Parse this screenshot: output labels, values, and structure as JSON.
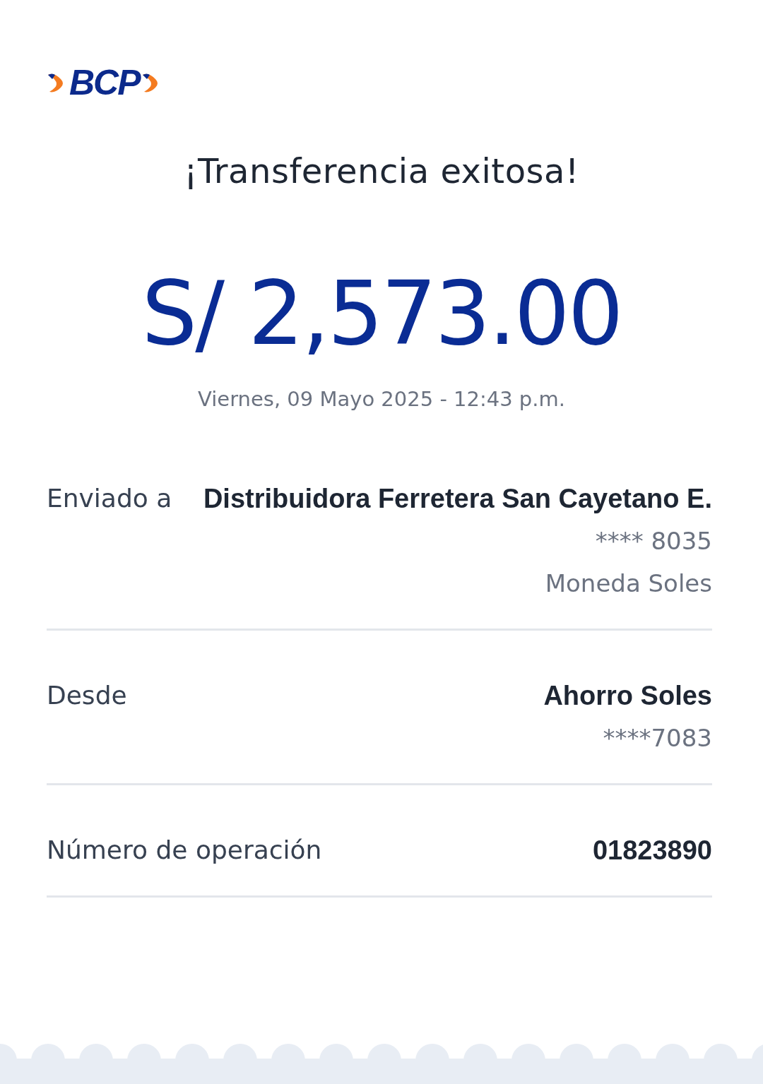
{
  "logo": {
    "text": "BCP"
  },
  "title": "¡Transferencia exitosa!",
  "amount": "S/ 2,573.00",
  "datetime": "Viernes, 09 Mayo 2025 - 12:43 p.m.",
  "details": [
    {
      "label": "Enviado a",
      "lines": [
        {
          "text": "Distribuidora Ferretera San Cayetano E.",
          "bold": true
        },
        {
          "text": "**** 8035",
          "bold": false
        },
        {
          "text": "Moneda Soles",
          "bold": false
        }
      ]
    },
    {
      "label": "Desde",
      "lines": [
        {
          "text": "Ahorro Soles",
          "bold": true
        },
        {
          "text": "****7083",
          "bold": false
        }
      ]
    },
    {
      "label": "Número de operación",
      "lines": [
        {
          "text": "01823890",
          "bold": true
        }
      ]
    }
  ]
}
